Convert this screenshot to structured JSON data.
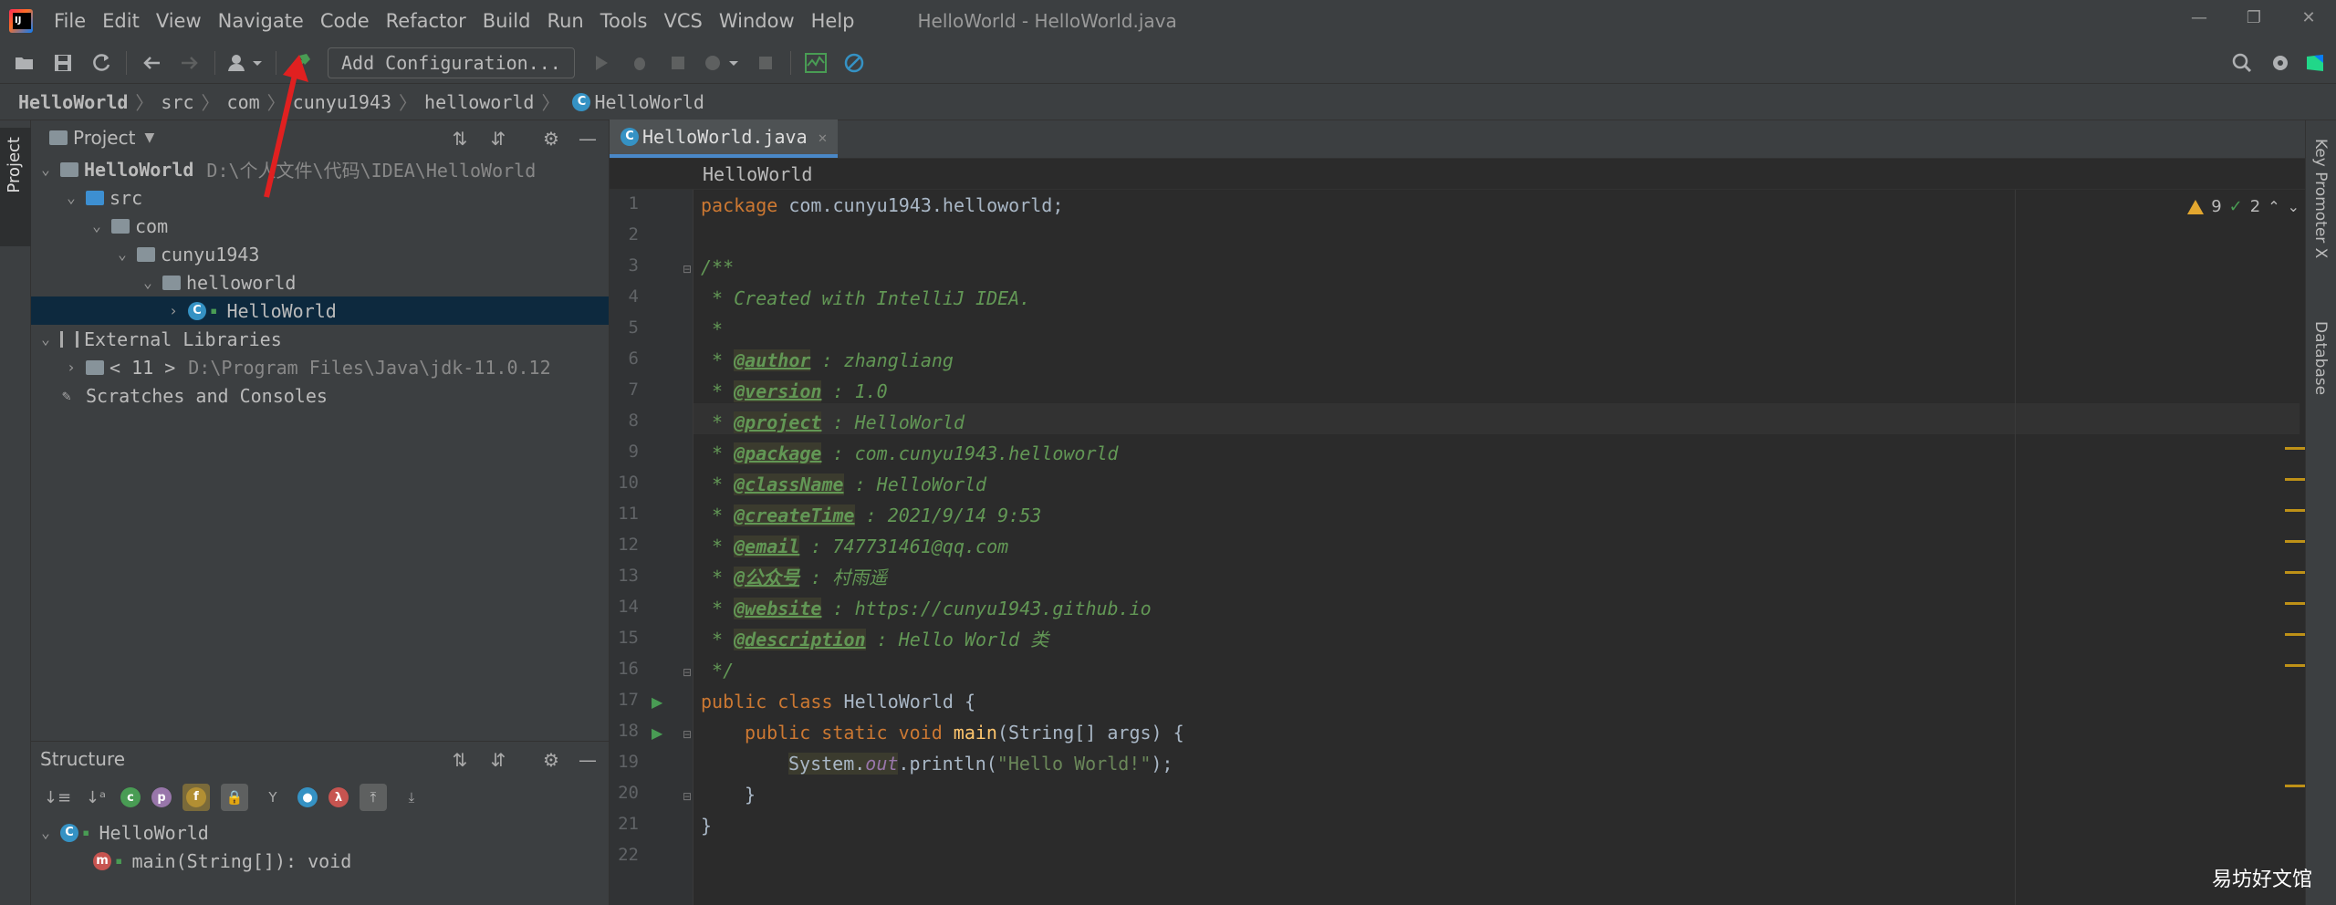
{
  "window": {
    "title": "HelloWorld - HelloWorld.java",
    "controls": [
      "—",
      "❐",
      "✕"
    ]
  },
  "menu": [
    "File",
    "Edit",
    "View",
    "Navigate",
    "Code",
    "Refactor",
    "Build",
    "Run",
    "Tools",
    "VCS",
    "Window",
    "Help"
  ],
  "toolbar": {
    "add_configuration": "Add Configuration..."
  },
  "breadcrumb": [
    "HelloWorld",
    "src",
    "com",
    "cunyu1943",
    "helloworld",
    "HelloWorld"
  ],
  "left_stripe": {
    "project_tab": "Project"
  },
  "right_stripe": {
    "key_promoter": "Key Promoter X",
    "database": "Database"
  },
  "project_panel": {
    "title": "Project",
    "tree": [
      {
        "label": "HelloWorld",
        "path": "D:\\个人文件\\代码\\IDEA\\HelloWorld"
      },
      {
        "label": "src"
      },
      {
        "label": "com"
      },
      {
        "label": "cunyu1943"
      },
      {
        "label": "helloworld"
      },
      {
        "label": "HelloWorld"
      },
      {
        "label": "External Libraries"
      },
      {
        "label": "< 11 >",
        "path": "D:\\Program Files\\Java\\jdk-11.0.12"
      },
      {
        "label": "Scratches and Consoles"
      }
    ]
  },
  "structure_panel": {
    "title": "Structure",
    "tree": [
      {
        "label": "HelloWorld"
      },
      {
        "label": "main(String[]): void"
      }
    ],
    "filter_icons": [
      "c",
      "p",
      "f",
      "🔒",
      "Y",
      "●",
      "λ"
    ]
  },
  "editor": {
    "tab": "HelloWorld.java",
    "breadcrumb": "HelloWorld",
    "inspections": {
      "warnings": "9",
      "weak_warnings": "2"
    },
    "line_numbers": [
      "1",
      "2",
      "3",
      "4",
      "5",
      "6",
      "7",
      "8",
      "9",
      "10",
      "11",
      "12",
      "13",
      "14",
      "15",
      "16",
      "17",
      "18",
      "19",
      "20",
      "21",
      "22"
    ],
    "code": {
      "l1_kw": "package ",
      "l1_rest": "com.cunyu1943.helloworld;",
      "l3": "/**",
      "l4": " * Created with IntelliJ IDEA.",
      "l5": " *",
      "l6_tag": "@author",
      "l6_rest": " : zhangliang",
      "l7_tag": "@version",
      "l7_rest": " : 1.0",
      "l8_tag": "@project",
      "l8_rest": " : HelloWorld",
      "l9_tag": "@package",
      "l9_rest": " : com.cunyu1943.helloworld",
      "l10_tag": "@className",
      "l10_rest": " : HelloWorld",
      "l11_tag": "@createTime",
      "l11_rest": " : 2021/9/14 9:53",
      "l12_tag": "@email",
      "l12_rest": " : 747731461@qq.com",
      "l13_tag": "@公众号",
      "l13_rest": " : 村雨遥",
      "l14_tag": "@website",
      "l14_rest": " : https://cunyu1943.github.io",
      "l15_tag": "@description",
      "l15_rest": " : Hello World 类",
      "l16": " */",
      "l17_kw": "public class ",
      "l17_rest": "HelloWorld {",
      "l18_kw": "public static void ",
      "l18_fn": "main",
      "l18_rest": "(String[] args) {",
      "l19_sys": "System.",
      "l19_out": "out",
      "l19_call": ".println(",
      "l19_str": "\"Hello World!\"",
      "l19_end": ");",
      "l20": "}",
      "l21": "}"
    }
  },
  "watermark": "易坊好文馆",
  "colors": {
    "background": "#2b2b2b",
    "panel": "#3c3f41",
    "keyword": "#cc7832",
    "comment": "#629755",
    "string": "#6a8759",
    "selection": "#0d293e",
    "annotation_arrow": "#e02020"
  }
}
